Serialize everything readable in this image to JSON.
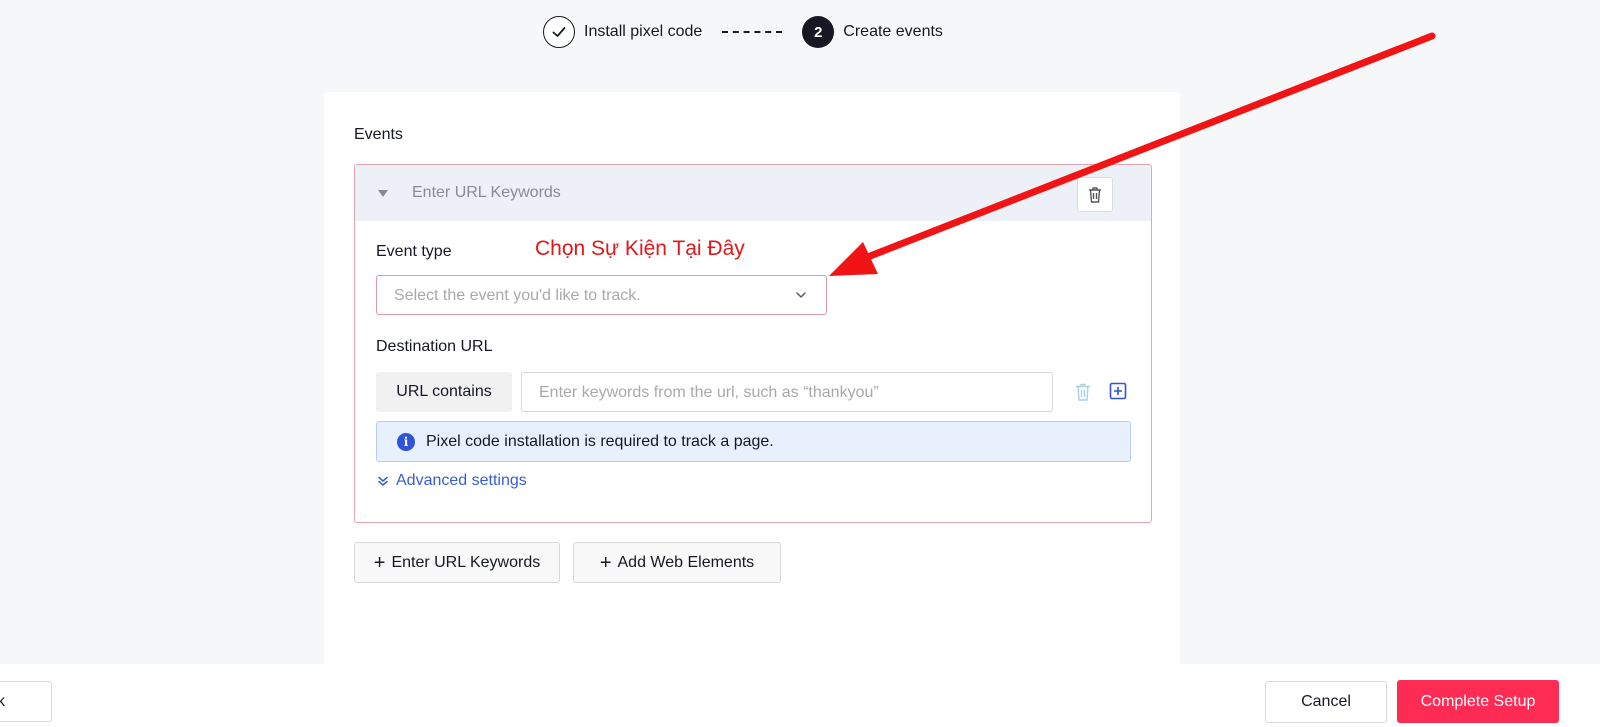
{
  "stepper": {
    "step1_label": "Install pixel code",
    "step2_number": "2",
    "step2_label": "Create events"
  },
  "events_section": {
    "title": "Events",
    "event_header_label": "Enter URL Keywords",
    "event_type_label": "Event type",
    "annotation_text": "Chọn Sự Kiện Tại Đây",
    "event_select_placeholder": "Select the event you'd like to track.",
    "destination_url_label": "Destination URL",
    "url_condition": "URL contains",
    "url_input_placeholder": "Enter keywords from the url, such as “thankyou”",
    "info_message": "Pixel code installation is required to track a page.",
    "info_icon": "i",
    "advanced_settings_label": "Advanced settings"
  },
  "actions": {
    "add_url_keywords": "Enter URL Keywords",
    "add_web_elements": "Add Web Elements",
    "plus": "+"
  },
  "footer": {
    "back_label": "k",
    "cancel_label": "Cancel",
    "complete_label": "Complete Setup"
  },
  "colors": {
    "primary": "#fe2c55",
    "annotation": "#e0171b",
    "link": "#3a5cd2",
    "info_bg": "#e8f0fe"
  },
  "icons": [
    "check-icon",
    "caret-down-icon",
    "trash-icon",
    "chevron-down-icon",
    "plus-square-icon",
    "info-icon",
    "double-chevron-down-icon",
    "plus-icon",
    "annotation-arrow"
  ]
}
